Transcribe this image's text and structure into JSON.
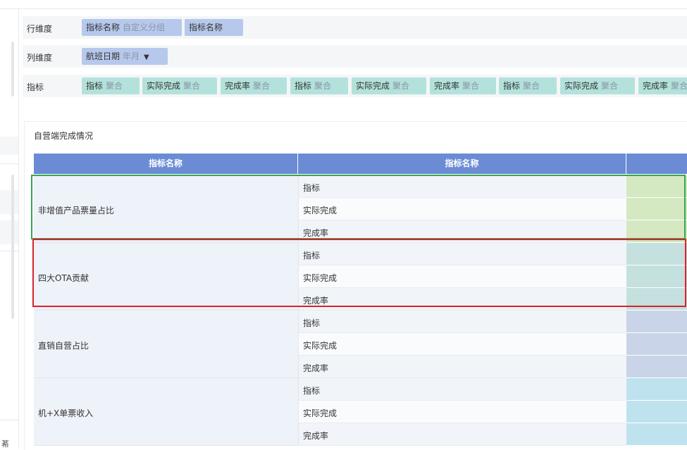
{
  "row_dimension": {
    "label": "行维度",
    "pills": [
      {
        "name": "指标名称",
        "sub": "自定义分组"
      },
      {
        "name": "指标名称",
        "sub": ""
      }
    ]
  },
  "column_dimension": {
    "label": "列维度",
    "pills": [
      {
        "name": "航班日期",
        "sub": "年月",
        "filter_icon": "funnel-icon"
      }
    ]
  },
  "metrics": {
    "label": "指标",
    "pills": [
      {
        "name": "指标",
        "sub": "聚合"
      },
      {
        "name": "实际完成",
        "sub": "聚合"
      },
      {
        "name": "完成率",
        "sub": "聚合"
      },
      {
        "name": "指标",
        "sub": "聚合"
      },
      {
        "name": "实际完成",
        "sub": "聚合"
      },
      {
        "name": "完成率",
        "sub": "聚合"
      },
      {
        "name": "指标",
        "sub": "聚合"
      },
      {
        "name": "实际完成",
        "sub": "聚合"
      },
      {
        "name": "完成率",
        "sub": "聚合"
      }
    ]
  },
  "card": {
    "title": "自营端完成情况"
  },
  "table": {
    "headers": [
      "指标名称",
      "指标名称",
      ""
    ],
    "groups": [
      {
        "label": "非增值产品票量占比",
        "rows": [
          "指标",
          "实际完成",
          "完成率"
        ],
        "value_color": "#d4e8c1"
      },
      {
        "label": "四大OTA贡献",
        "rows": [
          "指标",
          "实际完成",
          "完成率"
        ],
        "value_color": "#c4e0df"
      },
      {
        "label": "直销自营占比",
        "rows": [
          "指标",
          "实际完成",
          "完成率"
        ],
        "value_color": "#c9d4e8"
      },
      {
        "label": "机+X单票收入",
        "rows": [
          "指标",
          "实际完成",
          "完成率"
        ],
        "value_color": "#bfe2ef"
      }
    ]
  },
  "left_panel": {
    "partial_text": "莃"
  },
  "highlight_colors": {
    "green_box": "#33a852",
    "red_box": "#d9232b"
  }
}
